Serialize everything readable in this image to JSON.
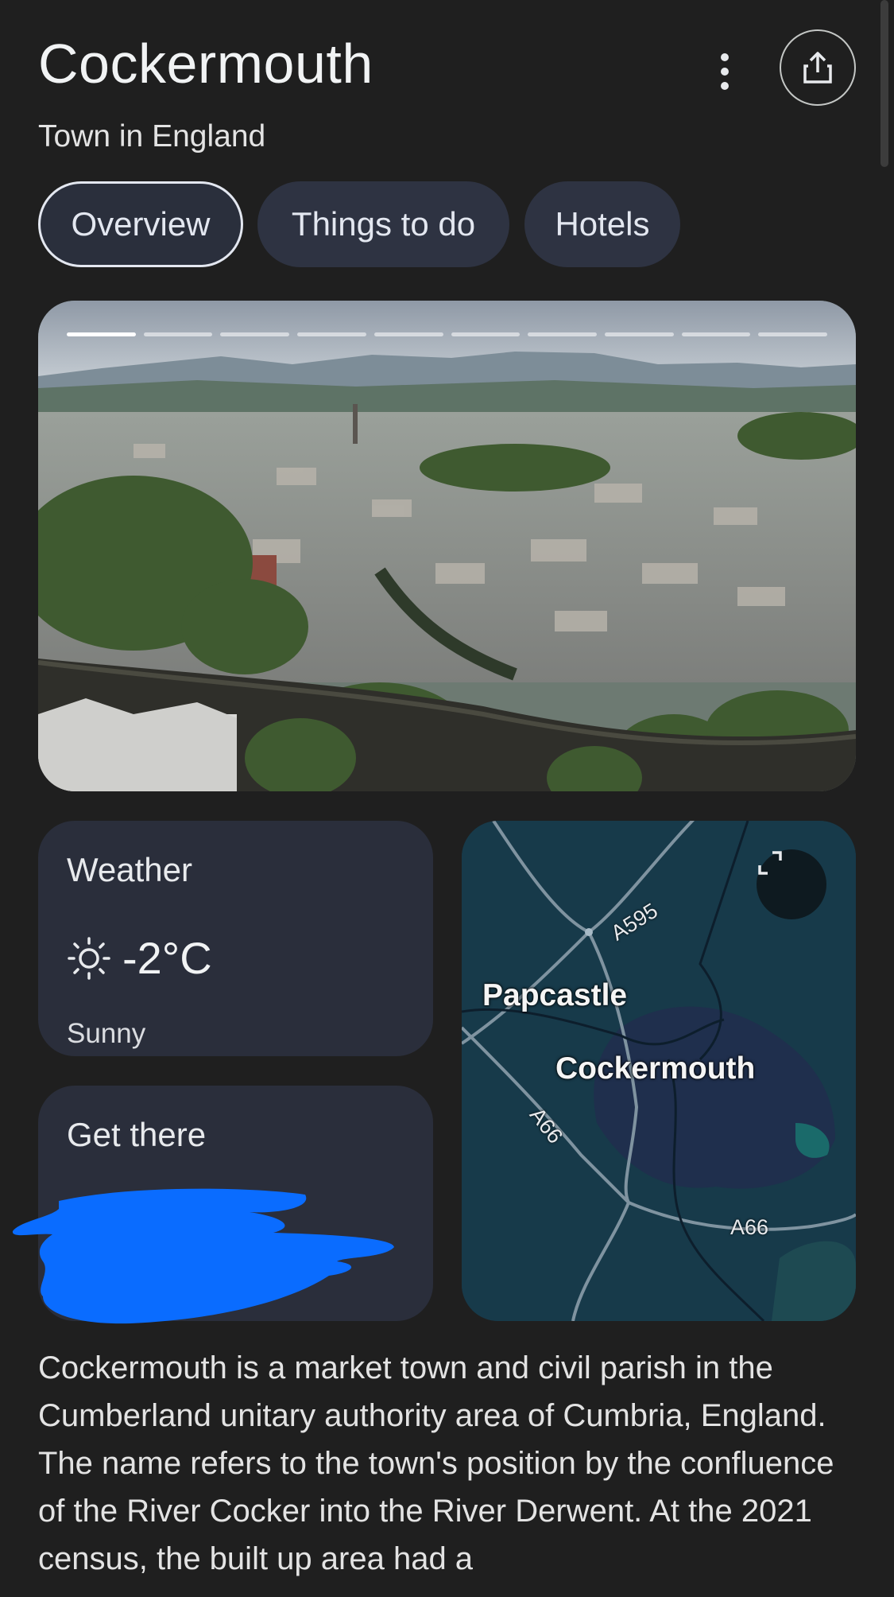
{
  "header": {
    "title": "Cockermouth",
    "subtitle": "Town in England"
  },
  "tabs": [
    {
      "label": "Overview",
      "active": true
    },
    {
      "label": "Things to do",
      "active": false
    },
    {
      "label": "Hotels",
      "active": false
    }
  ],
  "photo_carousel": {
    "total": 10,
    "current": 1
  },
  "weather": {
    "title": "Weather",
    "icon": "sun-icon",
    "temperature": "-2°C",
    "condition": "Sunny"
  },
  "get_there": {
    "title": "Get there"
  },
  "map": {
    "places": [
      "Papcastle",
      "Cockermouth"
    ],
    "roads": [
      "A595",
      "A66",
      "A66"
    ]
  },
  "description": "Cockermouth is a market town and civil parish in the Cumberland unitary authority area of Cumbria, England. The name refers to the town's position by the confluence of the River Cocker into the River Derwent. At the 2021 census, the built up area had a",
  "colors": {
    "background": "#1f1f1f",
    "card": "#2a2e3b",
    "chip": "#2e3342",
    "redaction_blue": "#0a6cff",
    "map_water": "#1a3a4a"
  }
}
